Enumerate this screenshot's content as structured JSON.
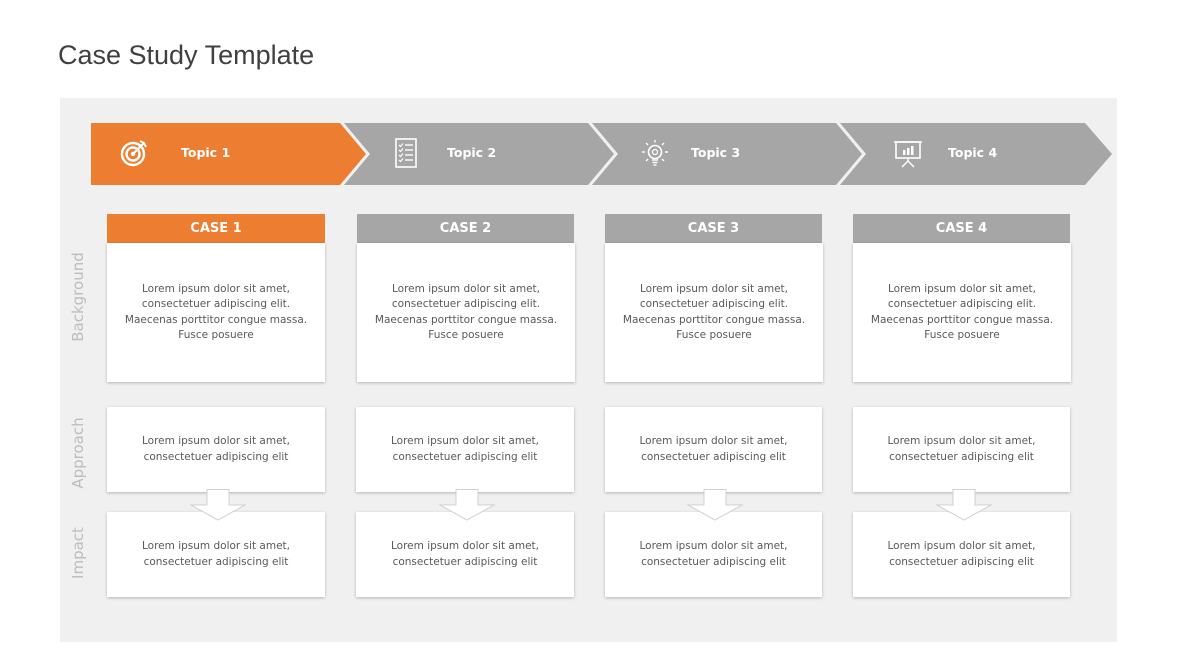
{
  "page": {
    "title": "Case Study Template"
  },
  "colors": {
    "accent": "#ed7d31",
    "inactive": "#a6a6a6",
    "panel": "#f0f0f0",
    "row_label": "#bdbdbd"
  },
  "topics": [
    {
      "label": "Topic 1",
      "icon": "target-icon",
      "active": true
    },
    {
      "label": "Topic 2",
      "icon": "checklist-icon",
      "active": false
    },
    {
      "label": "Topic 3",
      "icon": "lightbulb-icon",
      "active": false
    },
    {
      "label": "Topic 4",
      "icon": "presentation-chart-icon",
      "active": false
    }
  ],
  "row_labels": {
    "background": "Background",
    "approach": "Approach",
    "impact": "Impact"
  },
  "cases": [
    {
      "title": "CASE 1",
      "active": true,
      "background": "Lorem ipsum dolor sit amet, consectetuer adipiscing elit. Maecenas porttitor congue massa. Fusce posuere",
      "approach": "Lorem ipsum dolor sit amet, consectetuer adipiscing elit",
      "impact": "Lorem ipsum dolor sit amet, consectetuer adipiscing elit"
    },
    {
      "title": "CASE 2",
      "active": false,
      "background": "Lorem ipsum dolor sit amet, consectetuer adipiscing elit. Maecenas porttitor congue massa. Fusce posuere",
      "approach": "Lorem ipsum dolor sit amet, consectetuer adipiscing elit",
      "impact": "Lorem ipsum dolor sit amet, consectetuer adipiscing elit"
    },
    {
      "title": "CASE 3",
      "active": false,
      "background": "Lorem ipsum dolor sit amet, consectetuer adipiscing elit. Maecenas porttitor congue massa. Fusce posuere",
      "approach": "Lorem ipsum dolor sit amet, consectetuer adipiscing elit",
      "impact": "Lorem ipsum dolor sit amet, consectetuer adipiscing elit"
    },
    {
      "title": "CASE 4",
      "active": false,
      "background": "Lorem ipsum dolor sit amet, consectetuer adipiscing elit. Maecenas porttitor congue massa. Fusce posuere",
      "approach": "Lorem ipsum dolor sit amet, consectetuer adipiscing elit",
      "impact": "Lorem ipsum dolor sit amet, consectetuer adipiscing elit"
    }
  ]
}
